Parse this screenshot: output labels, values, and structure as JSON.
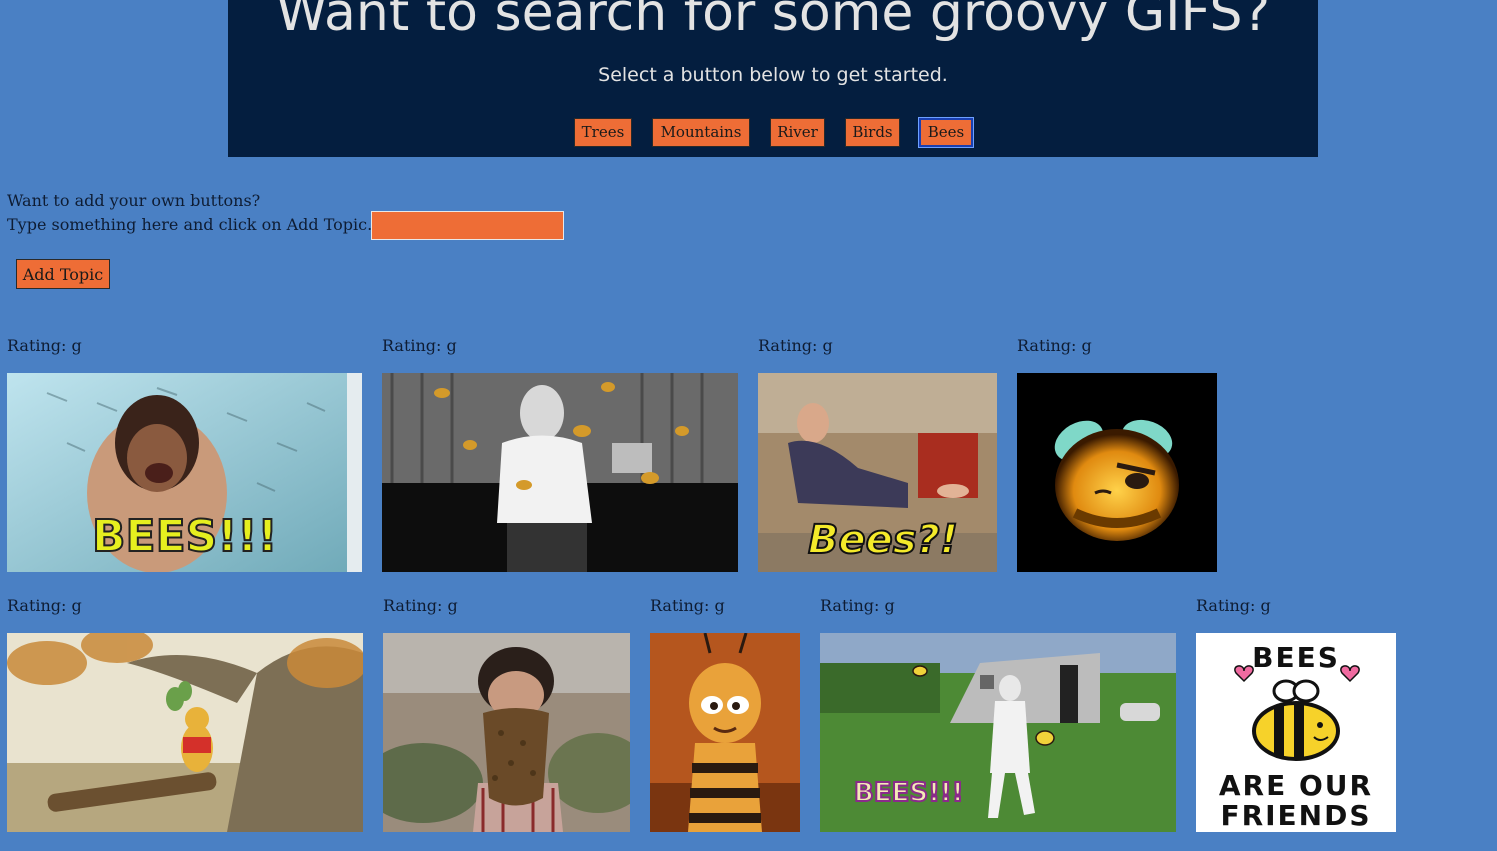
{
  "header": {
    "title": "Want to search for some groovy GIFS?",
    "subtitle": "Select a button below to get started."
  },
  "topics": [
    {
      "label": "Trees",
      "active": false
    },
    {
      "label": "Mountains",
      "active": false
    },
    {
      "label": "River",
      "active": false
    },
    {
      "label": "Birds",
      "active": false
    },
    {
      "label": "Bees",
      "active": true
    }
  ],
  "add_form": {
    "prompt_line1": "Want to add your own buttons?",
    "prompt_line2": "Type something here and click on Add Topic.",
    "input_value": "",
    "button_label": "Add Topic"
  },
  "gifs": [
    {
      "rating": "Rating: g",
      "caption": "BEES!!!",
      "subject": "woman-shouting-bees"
    },
    {
      "rating": "Rating: g",
      "caption": "",
      "subject": "man-dancing-with-bees"
    },
    {
      "rating": "Rating: g",
      "caption": "Bees?!",
      "subject": "man-on-couch"
    },
    {
      "rating": "Rating: g",
      "caption": "",
      "subject": "angry-cartoon-bee"
    },
    {
      "rating": "Rating: g",
      "caption": "",
      "subject": "winnie-the-pooh-tree"
    },
    {
      "rating": "Rating: g",
      "caption": "",
      "subject": "man-with-bee-beard"
    },
    {
      "rating": "Rating: g",
      "caption": "",
      "subject": "animated-bee-character"
    },
    {
      "rating": "Rating: g",
      "caption": "BEES!!!",
      "subject": "beekeeper-running"
    },
    {
      "rating": "Rating: g",
      "caption": "BEES ARE OUR FRIENDS",
      "subject": "bees-are-our-friends-sticker"
    }
  ],
  "colors": {
    "page_background": "#4a80c4",
    "header_background": "#041e3f",
    "button_orange": "#ee6d36",
    "active_border": "#1a3fb0"
  }
}
